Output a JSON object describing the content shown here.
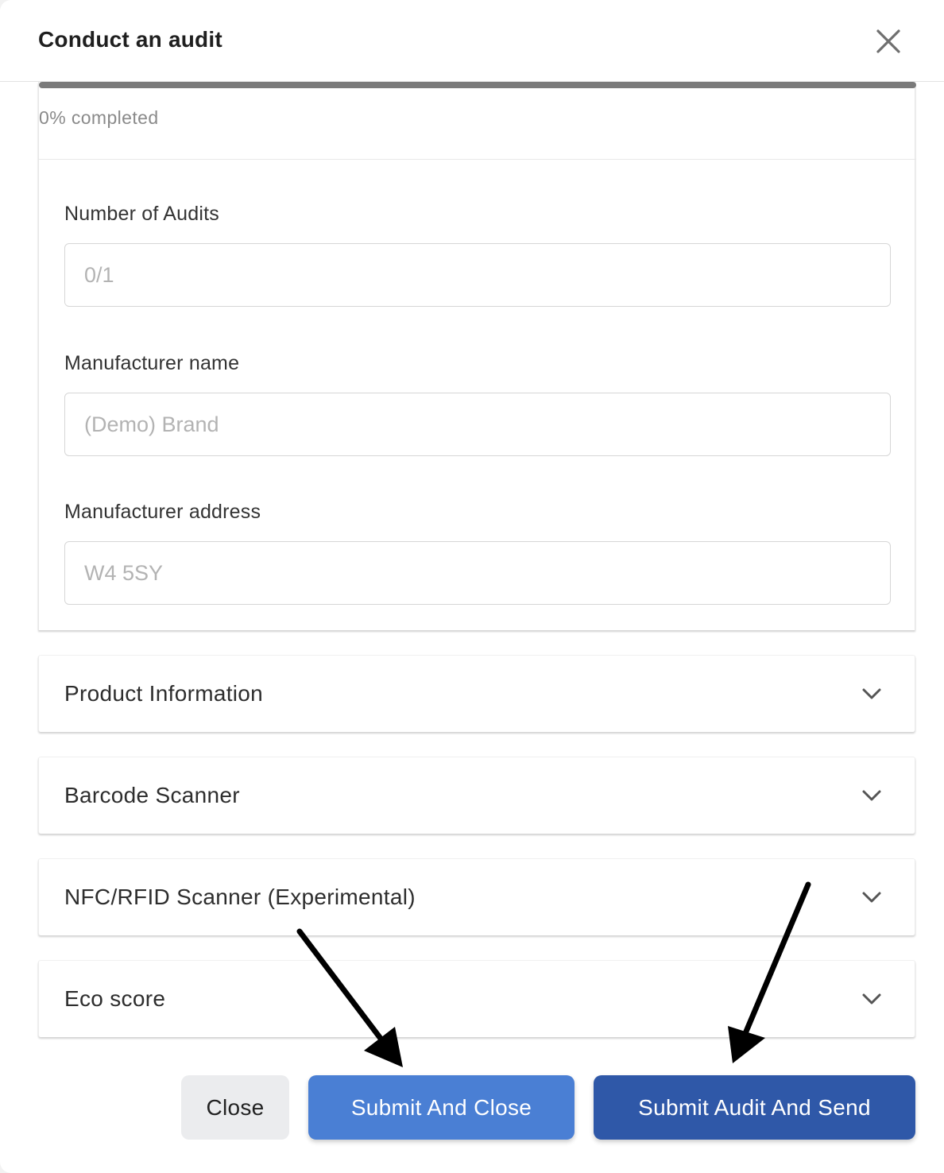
{
  "modal": {
    "title": "Conduct an audit",
    "close_icon": "close-icon"
  },
  "progress": {
    "text": "0% completed",
    "value_percent": 0
  },
  "form": {
    "fields": [
      {
        "label": "Number of Audits",
        "placeholder": "0/1"
      },
      {
        "label": "Manufacturer name",
        "placeholder": "(Demo) Brand"
      },
      {
        "label": "Manufacturer address",
        "placeholder": "W4 5SY"
      }
    ]
  },
  "sections": [
    {
      "label": "Product Information",
      "icon": "chevron-down-icon"
    },
    {
      "label": "Barcode Scanner",
      "icon": "chevron-down-icon"
    },
    {
      "label": "NFC/RFID Scanner (Experimental)",
      "icon": "chevron-down-icon"
    },
    {
      "label": "Eco score",
      "icon": "chevron-down-icon"
    }
  ],
  "footer": {
    "close_label": "Close",
    "submit_close_label": "Submit And Close",
    "submit_send_label": "Submit Audit And Send"
  },
  "colors": {
    "submit_close": "#4a7fd4",
    "submit_send": "#2f58a8",
    "close_button": "#ebecee"
  }
}
